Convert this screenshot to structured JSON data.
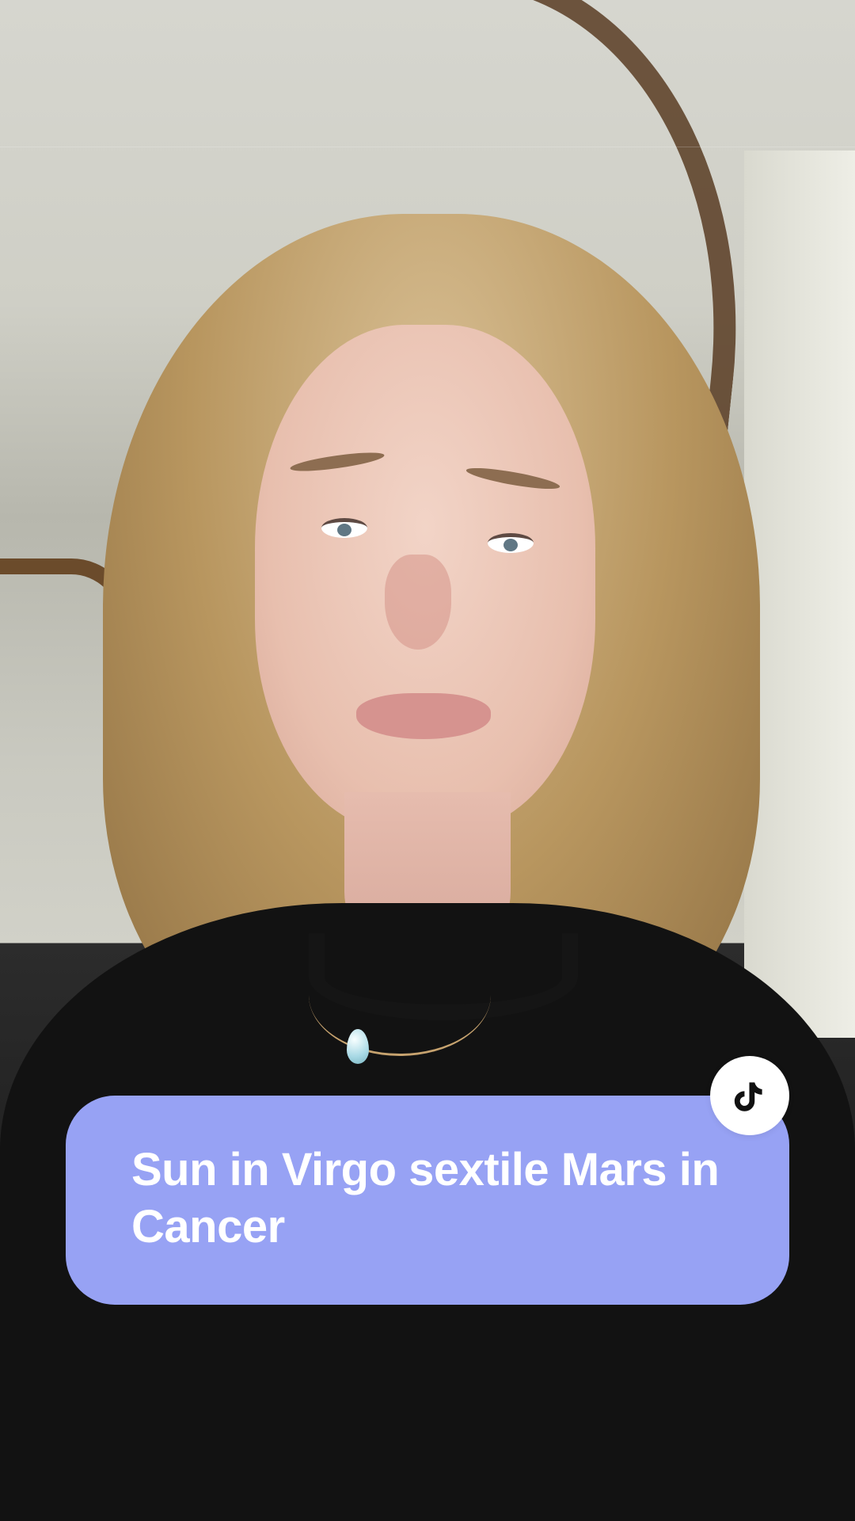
{
  "caption": {
    "text": "Sun in Virgo sextile Mars in Cancer"
  },
  "badge": {
    "icon": "tiktok-icon"
  },
  "colors": {
    "caption_background": "#97a2f4",
    "caption_text": "#ffffff",
    "badge_background": "#ffffff",
    "badge_icon": "#111111"
  }
}
